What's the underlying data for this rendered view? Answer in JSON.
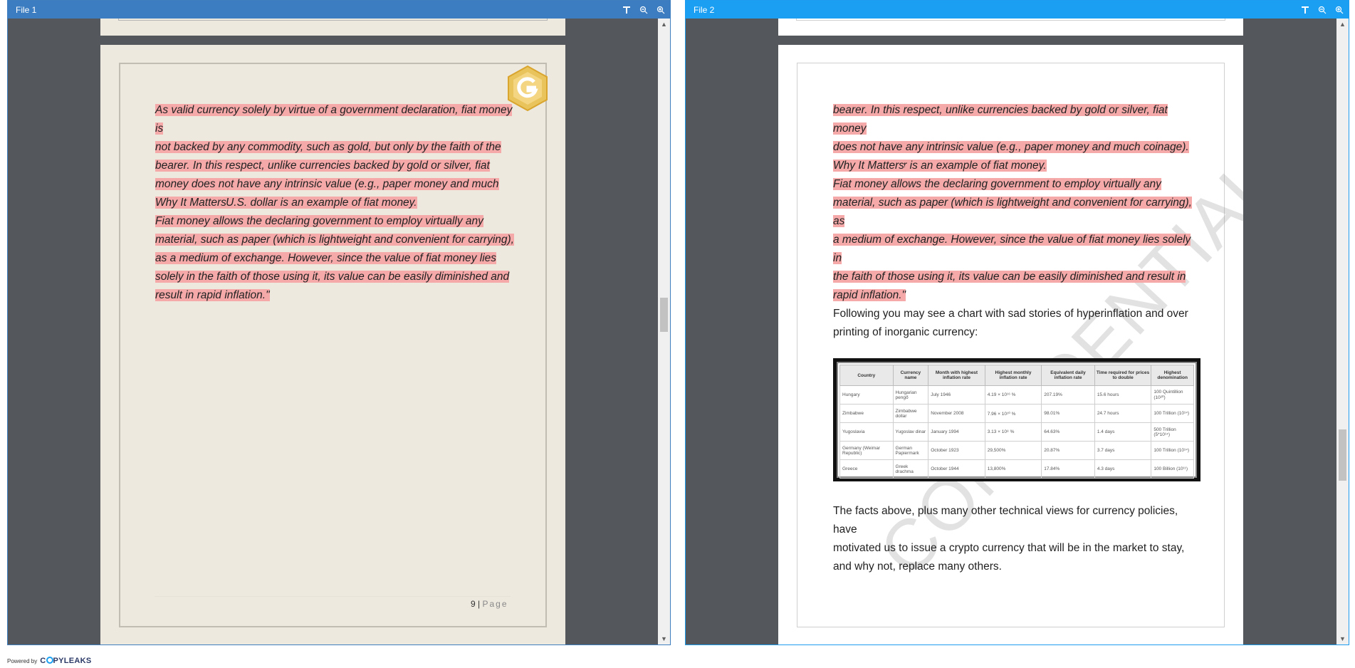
{
  "pane1": {
    "title": "File 1",
    "page_number": "9",
    "page_sep": "|",
    "page_word": "Page",
    "paragraphs": [
      [
        "As valid currency solely by virtue of a government declaration, fiat money is",
        "not backed by any commodity, such as gold, but only by the faith of the",
        "bearer. In this respect, unlike currencies backed by gold or silver, fiat",
        "money does not have any intrinsic value (e.g., paper money and much",
        "coinage). The U.S. dollar is an example of fiat money."
      ],
      [
        "Why It Matters",
        "Fiat money allows the declaring government to employ virtually any",
        "material, such as paper (which is lightweight and convenient for carrying),",
        "as a medium of exchange. However, since the value of fiat money lies",
        "solely in the faith of those using it, its value can be easily diminished and",
        "result in rapid inflation.\""
      ]
    ]
  },
  "pane2": {
    "title": "File 2",
    "paragraphs": [
      [
        "bearer. In this respect, unlike currencies backed by gold or silver, fiat money",
        "does not have any intrinsic value (e.g., paper money and much coinage).",
        "The U.S. dollar is an example of fiat money."
      ],
      [
        "Why It Matters",
        "Fiat money allows the declaring government to employ virtually any",
        "material, such as paper (which is lightweight and convenient for carrying), as",
        "a medium of exchange. However, since the value of fiat money lies solely in",
        "the faith of those using it, its value can be easily diminished and result in",
        "rapid inflation.\""
      ]
    ],
    "chart_intro": [
      "Following you may see a chart with sad stories of hyperinflation and over",
      "printing of inorganic currency:"
    ],
    "closing": [
      "The facts above, plus many other technical views for currency policies, have",
      "motivated us to issue a crypto currency that will be in the market to stay,",
      "and why not, replace many others."
    ],
    "watermark": "CONFIDENTIAL",
    "table": {
      "headers": [
        "Country",
        "Currency name",
        "Month with highest inflation rate",
        "Highest monthly inflation rate",
        "Equivalent daily inflation rate",
        "Time required for prices to double",
        "Highest denomination"
      ],
      "rows": [
        [
          "Hungary",
          "Hungarian pengő",
          "July 1946",
          "4.19 × 10¹⁶ %",
          "207.19%",
          "15.6 hours",
          "100 Quintillion (10²⁰)"
        ],
        [
          "Zimbabwe",
          "Zimbabwe dollar",
          "November 2008",
          "7.96 × 10¹⁰ %",
          "98.01%",
          "24.7 hours",
          "100 Trillion (10¹⁴)"
        ],
        [
          "Yugoslavia",
          "Yugoslav dinar",
          "January 1994",
          "3.13 × 10⁸ %",
          "64.63%",
          "1.4 days",
          "500 Trillion (5*10¹⁴)"
        ],
        [
          "Germany (Weimar Republic)",
          "German Papiermark",
          "October 1923",
          "29,500%",
          "20.87%",
          "3.7 days",
          "100 Trillion (10¹⁴)"
        ],
        [
          "Greece",
          "Greek drachma",
          "October 1944",
          "13,800%",
          "17.84%",
          "4.3 days",
          "100 Billion (10¹¹)"
        ]
      ]
    }
  },
  "footer": {
    "powered": "Powered by",
    "brand_pre": "C",
    "brand_post": "PYLEAKS"
  },
  "colors": {
    "pane1_title": "#3b7dc0",
    "pane2_title": "#1b9ff2",
    "highlight": "#f5a9a9",
    "viewer_bg": "#54585c"
  },
  "icons": [
    "text-icon",
    "zoom-out-icon",
    "zoom-in-icon",
    "g-logo-icon"
  ]
}
